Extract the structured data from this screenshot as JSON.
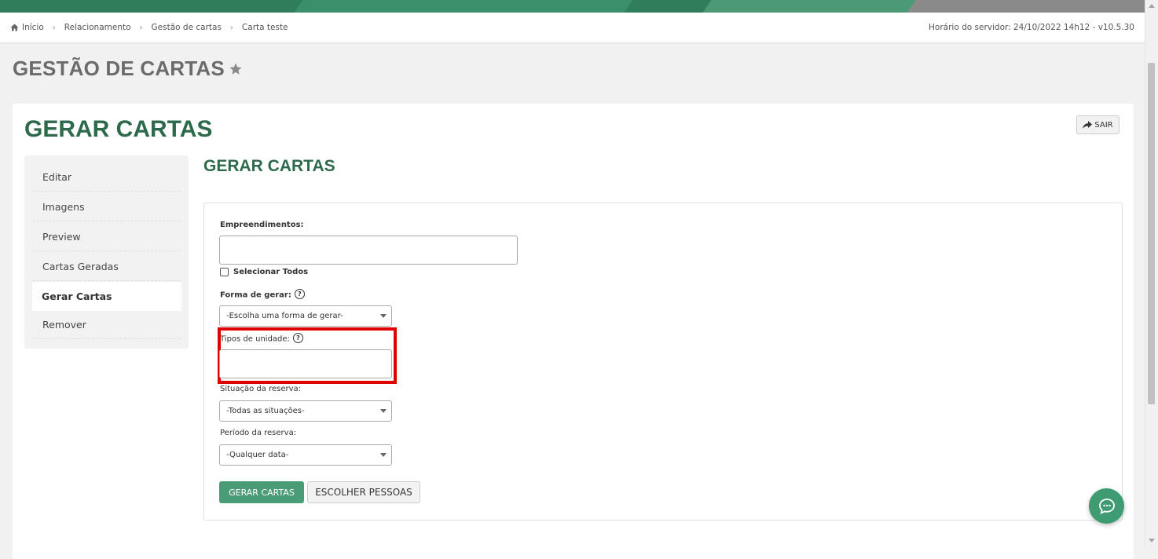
{
  "breadcrumb": {
    "items": [
      "Início",
      "Relacionamento",
      "Gestão de cartas",
      "Carta teste"
    ]
  },
  "server_time": "Horário do servidor: 24/10/2022 14h12 - v10.5.30",
  "page_title": "GESTÃO DE CARTAS",
  "card": {
    "title": "GERAR CARTAS",
    "exit_label": "SAIR"
  },
  "sidebar": {
    "items": [
      {
        "label": "Editar"
      },
      {
        "label": "Imagens"
      },
      {
        "label": "Preview"
      },
      {
        "label": "Cartas Geradas"
      },
      {
        "label": "Gerar Cartas"
      },
      {
        "label": "Remover"
      }
    ]
  },
  "section_title": "GERAR CARTAS",
  "form": {
    "empreendimentos_label": "Empreendimentos:",
    "empreendimentos_value": "",
    "select_all_label": "Selecionar Todos",
    "forma_label": "Forma de gerar:",
    "forma_value": "-Escolha uma forma de gerar-",
    "tipos_label": "Tipos de unidade:",
    "tipos_value": "",
    "situacao_label": "Situação da reserva:",
    "situacao_value": "-Todas as situações-",
    "periodo_label": "Período da reserva:",
    "periodo_value": "-Qualquer data-",
    "generate_button": "GERAR CARTAS",
    "choose_people_button": "ESCOLHER PESSOAS"
  },
  "colors": {
    "brand_green": "#2d6a4b",
    "button_green": "#4a9c77",
    "highlight_red": "#e00000"
  }
}
